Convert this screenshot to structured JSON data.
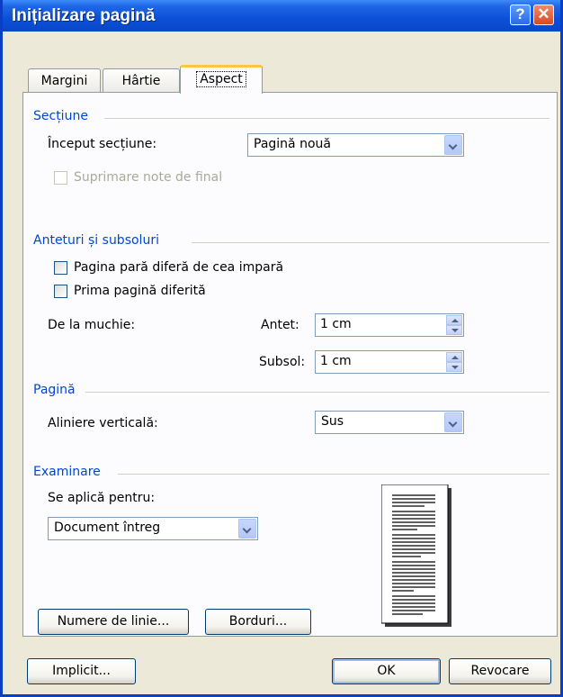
{
  "window": {
    "title": "Inițializare pagină"
  },
  "titlebar_buttons": {
    "help": "?",
    "close": "✕"
  },
  "tabs": [
    {
      "label": "Margini",
      "active": false
    },
    {
      "label": "Hârtie",
      "active": false
    },
    {
      "label": "Aspect",
      "active": true
    }
  ],
  "section": {
    "title": "Secțiune",
    "start_label": "Început secțiune:",
    "start_value": "Pagină nouă",
    "suppress_endnotes": "Suprimare note de final"
  },
  "headers": {
    "title": "Anteturi și subsoluri",
    "odd_even": "Pagina pară diferă de cea impară",
    "first_page": "Prima pagină diferită",
    "from_edge": "De la muchie:",
    "header_label": "Antet:",
    "header_value": "1 cm",
    "footer_label": "Subsol:",
    "footer_value": "1 cm"
  },
  "page": {
    "title": "Pagină",
    "valign_label": "Aliniere verticală:",
    "valign_value": "Sus"
  },
  "preview": {
    "title": "Examinare",
    "apply_label": "Se aplică pentru:",
    "apply_value": "Document întreg"
  },
  "buttons": {
    "line_numbers": "Numere de linie...",
    "borders": "Borduri...",
    "default": "Implicit...",
    "ok": "OK",
    "cancel": "Revocare"
  }
}
